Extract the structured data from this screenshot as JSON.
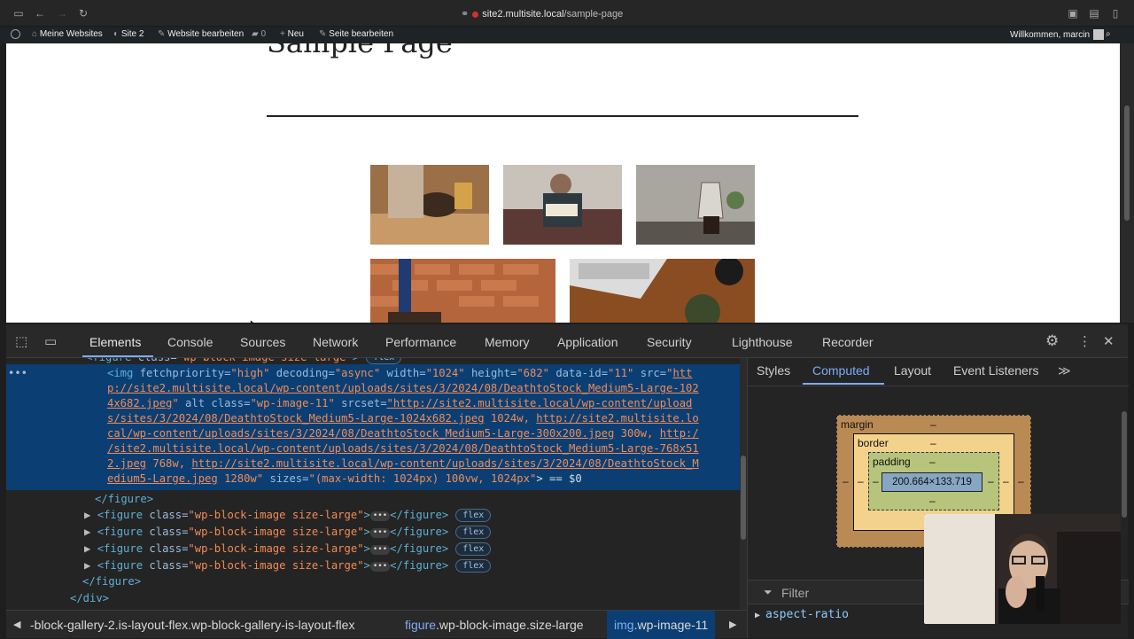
{
  "browser": {
    "url_host": "site2.multisite.local",
    "url_path": "/sample-page"
  },
  "wp_admin_bar": {
    "my_sites": "Meine Websites",
    "site": "Site 2",
    "customize": "Website bearbeiten",
    "comments_count": "0",
    "new": "Neu",
    "edit_page": "Seite bearbeiten",
    "greeting": "Willkommen, marcin"
  },
  "page": {
    "title": "Sample Page"
  },
  "devtools": {
    "tabs": [
      "Elements",
      "Console",
      "Sources",
      "Network",
      "Performance",
      "Memory",
      "Application",
      "Security",
      "Lighthouse",
      "Recorder"
    ],
    "side_tabs": [
      "Styles",
      "Computed",
      "Layout",
      "Event Listeners"
    ],
    "dom": {
      "line_top_tag": "<figure class=\"wp-block-image size-large\">",
      "line_top_badge": "flex",
      "img_line1_attrs_prefix": "<img fetchpriority=\"high\" decoding=\"async\" width=\"1024\" height=\"682\" data-id=\"11\" src=\"",
      "img_line1_link": "htt",
      "img_line2_link": "p://site2.multisite.local/wp-content/uploads/sites/3/2024/08/DeathtoStock_Medium5-Large-102",
      "img_line3_link": "4x682.jpeg",
      "img_line3_rest_alt": " alt class=",
      "img_line3_class_value": "\"wp-image-11\"",
      "img_line3_srcset": " srcset=",
      "img_line3_srcset_link": "\"http://site2.multisite.local/wp-content/upload",
      "img_line4_link": "s/sites/3/2024/08/DeathtoStock_Medium5-Large-1024x682.jpeg",
      "img_line4_size": " 1024w, ",
      "img_line4_link2": "http://site2.multisite.lo",
      "img_line5_link": "cal/wp-content/uploads/sites/3/2024/08/DeathtoStock_Medium5-Large-300x200.jpeg",
      "img_line5_size": " 300w, ",
      "img_line5_link2": "http:/",
      "img_line6_link": "/site2.multisite.local/wp-content/uploads/sites/3/2024/08/DeathtoStock_Medium5-Large-768x51",
      "img_line7_link": "2.jpeg",
      "img_line7_size": " 768w, ",
      "img_line7_link2": "http://site2.multisite.local/wp-content/uploads/sites/3/2024/08/DeathtoStock_M",
      "img_line8_link": "edium5-Large.jpeg",
      "img_line8_size": " 1280w\"",
      "img_line8_sizes_attr": " sizes=",
      "img_line8_sizes_value": "\"(max-width: 1024px) 100vw, 1024px\"",
      "img_line8_end": "> == $0",
      "close_figure": "</figure>",
      "collapsed_figure_open": "<figure class=\"wp-block-image size-large\">",
      "collapsed_figure_close": "</figure>",
      "collapsed_badge": "flex",
      "close_figure_outer": "</figure>",
      "close_div": "</div>"
    },
    "breadcrumbs": [
      {
        "tag": "",
        "rest": "-block-gallery-2.is-layout-flex.wp-block-gallery-is-layout-flex"
      },
      {
        "tag": "figure",
        "rest": ".wp-block-image.size-large"
      },
      {
        "tag": "img",
        "rest": ".wp-image-11"
      }
    ],
    "box_model": {
      "margin_label": "margin",
      "border_label": "border",
      "padding_label": "padding",
      "dash": "–",
      "content": "200.664×133.719"
    },
    "filter_placeholder": "Filter",
    "first_property": "aspect-ratio"
  }
}
